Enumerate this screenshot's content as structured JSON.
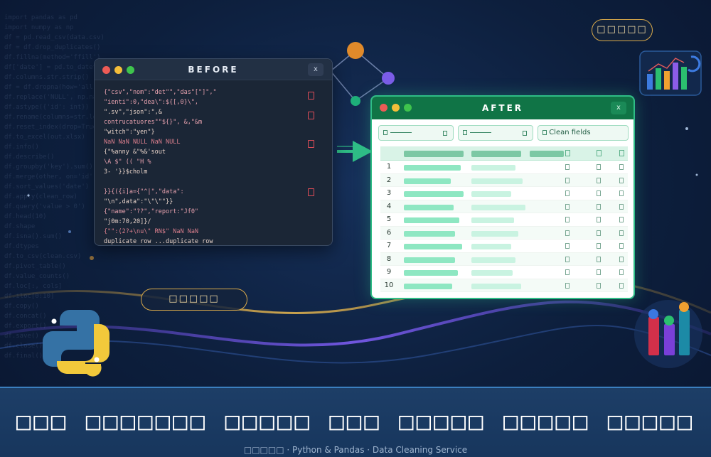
{
  "before_window": {
    "title": "BEFORE",
    "close_label": "x",
    "code_lines": [
      "{\"csv\",\"nom\":\"det\"\",\"das\"[\"]\",\"",
      "\"ienti\":0,\"dea\\\":${[,0}\\\",",
      "\".sv\",\"json\":\",&",
      "contrucatuores\"\"${}\", &,\"&m",
      "\"witch\":\"yen\"}",
      "NaN NaN NULL NaN NULL",
      "{\"%anny &\"%&'sout",
      "\\A $\" (( \"H %",
      "3- '}}$cholm",
      "",
      "}}{({i]a={\"^|\",\"data\":",
      "\"\\n\",data\":\"\\\"\\\"\"}}",
      "{\"name\":\"??\",\"report:\"Jf0\"",
      "\"j0m:70,20]}/",
      "{\"\":(2?+\\nu\\\" RN$\" NaN NaN",
      "duplicate row ...duplicate row"
    ]
  },
  "after_window": {
    "title": "AFTER",
    "close_label": "x",
    "toolbar": {
      "clean_fields_label": "Clean fields"
    },
    "rows": [
      "1",
      "2",
      "3",
      "4",
      "5",
      "6",
      "7",
      "8",
      "9",
      "10"
    ]
  },
  "badges": {
    "top_right": "□□□□□",
    "left": "□□□□□"
  },
  "footer": {
    "headline": "□□□ □□□□□□□ □□□□□ □□□ □□□□□ □□□□□ □□□□□",
    "subline": "□□□□□ · Python & Pandas · Data Cleaning Service"
  },
  "colors": {
    "before_accent": "#e14d58",
    "after_accent": "#2fbd86",
    "after_titlebar": "#107446",
    "badge_border": "#d9a94a"
  },
  "icons": [
    "python-logo-icon",
    "bar-chart-icon",
    "network-graph-icon",
    "arrow-right-icon"
  ]
}
